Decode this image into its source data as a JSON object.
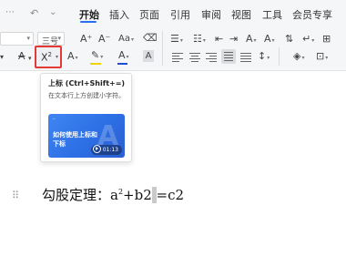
{
  "quick_access": {
    "save_icon": "save-icon",
    "undo_icon": "undo-icon",
    "redo_icon": "redo-icon",
    "more_icon": "more-icon"
  },
  "tabs": [
    {
      "label": "开始",
      "active": true
    },
    {
      "label": "插入",
      "active": false
    },
    {
      "label": "页面",
      "active": false
    },
    {
      "label": "引用",
      "active": false
    },
    {
      "label": "审阅",
      "active": false
    },
    {
      "label": "视图",
      "active": false
    },
    {
      "label": "工具",
      "active": false
    },
    {
      "label": "会员专享",
      "active": false
    }
  ],
  "font": {
    "size_value": "三号"
  },
  "toolbar": {
    "grow_font": "A⁺",
    "shrink_font": "A⁻",
    "clear_format_icon": "eraser-icon",
    "superscript_label": "X",
    "superscript_mark": "2",
    "text_effect": "A",
    "highlight_color": "#f2d200",
    "font_color": "#1d4ed8",
    "char_shading": "A"
  },
  "tooltip": {
    "title": "上标 (Ctrl+Shift+=)",
    "description": "在文本行上方创建小字符。",
    "video_title": "如何使用上标和下标",
    "video_duration": "01:13"
  },
  "document": {
    "text_before": "勾股定理：a",
    "sup": "2",
    "text_middle": "+b2",
    "selected_char": "",
    "text_after": "=c2"
  },
  "colors": {
    "accent": "#2a6ef5",
    "highlight_border": "#e53935"
  }
}
